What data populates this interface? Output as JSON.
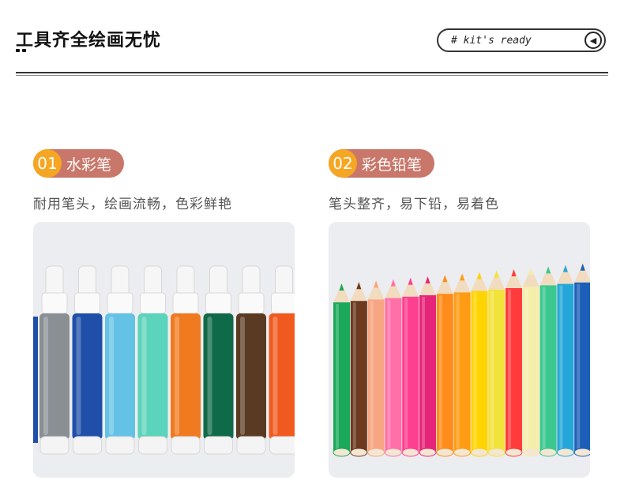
{
  "header": {
    "title": "工具齐全绘画无忧",
    "pill_text": "# kit's ready",
    "arrow_glyph": "◀"
  },
  "sections": [
    {
      "num": "01",
      "label": "水彩笔",
      "subtitle": "耐用笔头，绘画流畅，色彩鲜艳",
      "image": "markers-photo"
    },
    {
      "num": "02",
      "label": "彩色铅笔",
      "subtitle": "笔头整齐，易下铅，易着色",
      "image": "pencils-photo"
    }
  ],
  "colors": {
    "badge_bg": "#c9776a",
    "badge_num_bg": "#f5a623",
    "markers": [
      "#8a8f94",
      "#1f4fa8",
      "#63c2e6",
      "#5cd3bb",
      "#f07a1f",
      "#0f6a4a",
      "#5a3a22",
      "#f05a1e"
    ],
    "pencils": [
      "#1aa85a",
      "#6b3a1f",
      "#f7a582",
      "#ff6fa8",
      "#ff3f8f",
      "#e6257a",
      "#ff8b1a",
      "#ff9c14",
      "#ffd400",
      "#f2e33a",
      "#ff3b3b",
      "#f5eeaa",
      "#3cc78f",
      "#24a7d8",
      "#1d5fb8"
    ]
  }
}
